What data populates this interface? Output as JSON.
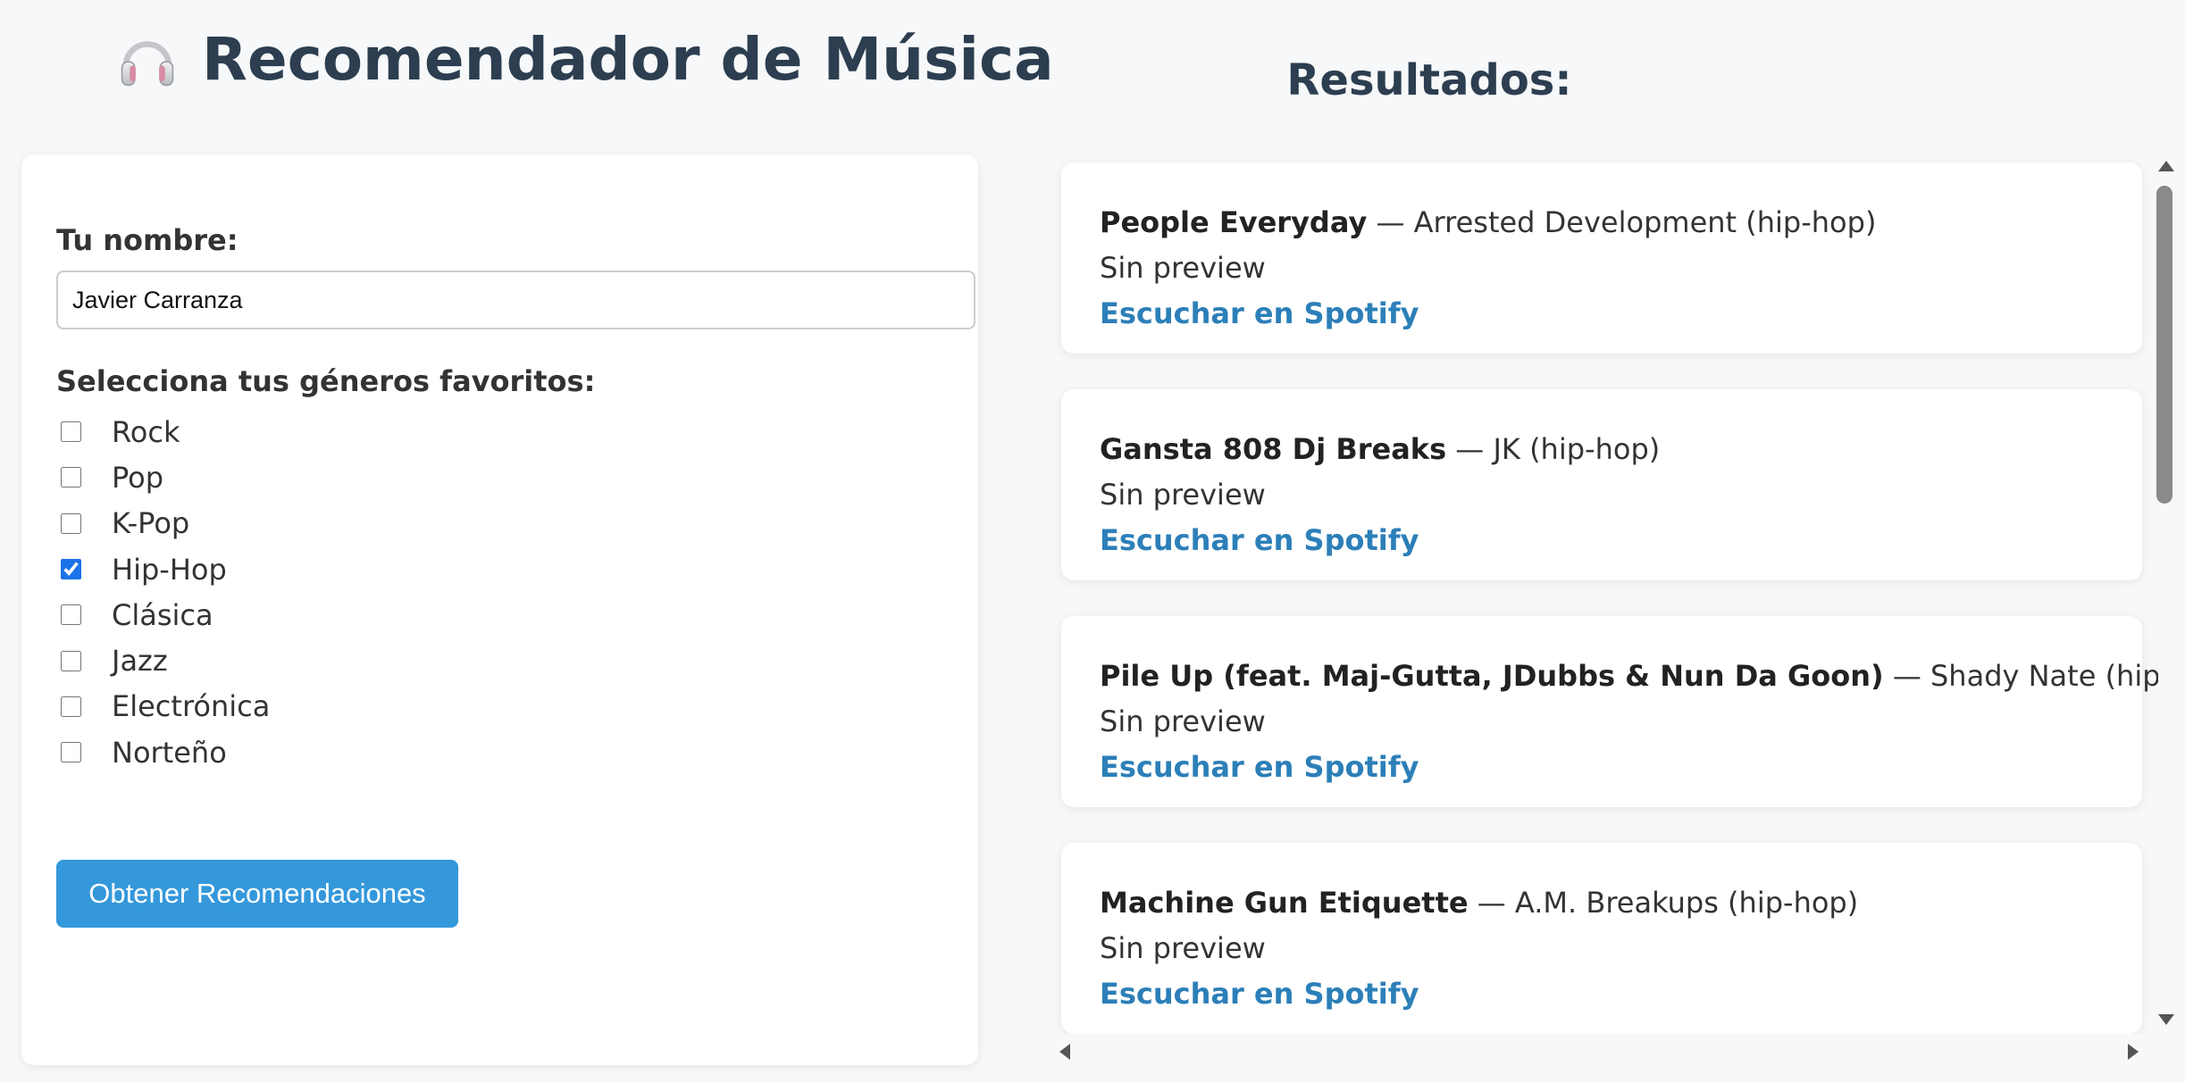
{
  "app": {
    "title": "Recomendador de Música"
  },
  "form": {
    "name_label": "Tu nombre:",
    "name_value": "Javier Carranza",
    "genres_label": "Selecciona tus géneros favoritos:",
    "genres": [
      {
        "label": "Rock",
        "checked": false
      },
      {
        "label": "Pop",
        "checked": false
      },
      {
        "label": "K-Pop",
        "checked": false
      },
      {
        "label": "Hip-Hop",
        "checked": true
      },
      {
        "label": "Clásica",
        "checked": false
      },
      {
        "label": "Jazz",
        "checked": false
      },
      {
        "label": "Electrónica",
        "checked": false
      },
      {
        "label": "Norteño",
        "checked": false
      }
    ],
    "submit_label": "Obtener Recomendaciones"
  },
  "results": {
    "title": "Resultados:",
    "items": [
      {
        "song": "People Everyday",
        "meta": " — Arrested Development (hip-hop)",
        "preview": "Sin preview",
        "link": "Escuchar en Spotify"
      },
      {
        "song": "Gansta 808 Dj Breaks",
        "meta": " — JK (hip-hop)",
        "preview": "Sin preview",
        "link": "Escuchar en Spotify"
      },
      {
        "song": "Pile Up (feat. Maj-Gutta, JDubbs & Nun Da Goon)",
        "meta": " — Shady Nate (hip-hop)",
        "preview": "Sin preview",
        "link": "Escuchar en Spotify"
      },
      {
        "song": "Machine Gun Etiquette",
        "meta": " — A.M. Breakups (hip-hop)",
        "preview": "Sin preview",
        "link": "Escuchar en Spotify"
      }
    ]
  },
  "icons": {
    "title_icon": "headphones-icon"
  },
  "colors": {
    "accent": "#3498db",
    "link": "#2c7fb8",
    "heading": "#2c3e50",
    "checkbox": "#1a73e8"
  }
}
